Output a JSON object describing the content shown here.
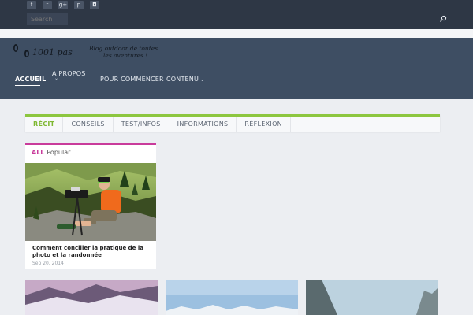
{
  "topbar": {
    "social": [
      {
        "icon": "facebook-icon",
        "glyph": "f"
      },
      {
        "icon": "twitter-icon",
        "glyph": "t"
      },
      {
        "icon": "google-plus-icon",
        "glyph": "g+"
      },
      {
        "icon": "pinterest-icon",
        "glyph": "p"
      },
      {
        "icon": "instagram-icon",
        "glyph": "◘"
      }
    ],
    "search_placeholder": "Search"
  },
  "header": {
    "logo_text": "1001 pas",
    "tagline_line1": "Blog outdoor de toutes",
    "tagline_line2": "les aventures !",
    "nav": {
      "accueil": "ACCUEIL",
      "apropos": "A PROPOS",
      "commencer": "POUR COMMENCER",
      "contenu": "CONTENU"
    }
  },
  "tabs": [
    "RÉCIT",
    "CONSEILS",
    "TEST/INFOS",
    "INFORMATIONS",
    "RÉFLEXION"
  ],
  "card": {
    "filter_all": "ALL",
    "filter_popular": "Popular",
    "title": "Comment concilier la pratique de la photo et la randonnée",
    "date": "Sep 20, 2014"
  },
  "colors": {
    "topbar": "#2e3745",
    "header": "#3e4e63",
    "accent_green": "#8cc63f",
    "accent_magenta": "#c93b9b"
  }
}
